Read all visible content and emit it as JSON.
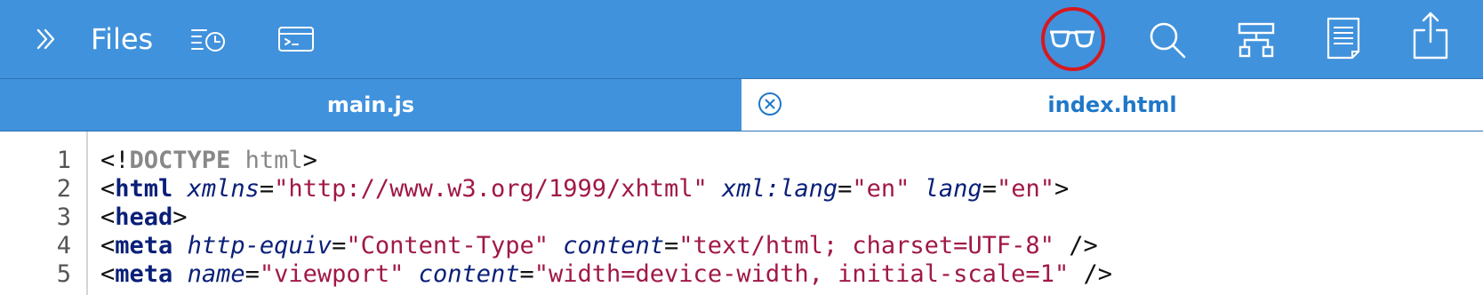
{
  "toolbar": {
    "files_label": "Files",
    "left_icons": [
      "chevron-double-right-icon",
      "recent-files-icon",
      "terminal-icon"
    ],
    "right_icons": [
      "reading-glasses-icon",
      "search-icon",
      "hierarchy-icon",
      "document-icon",
      "share-icon"
    ],
    "highlighted_icon": "reading-glasses-icon",
    "background_color": "#4192dc",
    "highlight_color": "#d61920"
  },
  "tabs": [
    {
      "label": "main.js",
      "active": false
    },
    {
      "label": "index.html",
      "active": true,
      "close_icon": "close-circle-icon"
    }
  ],
  "editor": {
    "lines": [
      {
        "number": "1",
        "tokens": [
          {
            "t": "punc",
            "v": "<!"
          },
          {
            "t": "doctype",
            "v": "DOCTYPE"
          },
          {
            "t": "doctype-name",
            "v": " html"
          },
          {
            "t": "punc",
            "v": ">"
          }
        ]
      },
      {
        "number": "2",
        "tokens": [
          {
            "t": "punc",
            "v": "<"
          },
          {
            "t": "tag",
            "v": "html"
          },
          {
            "t": "punc",
            "v": " "
          },
          {
            "t": "attr",
            "v": "xmlns"
          },
          {
            "t": "eq",
            "v": "="
          },
          {
            "t": "str",
            "v": "\"http://www.w3.org/1999/xhtml\""
          },
          {
            "t": "punc",
            "v": " "
          },
          {
            "t": "attr",
            "v": "xml:lang"
          },
          {
            "t": "eq",
            "v": "="
          },
          {
            "t": "str",
            "v": "\"en\""
          },
          {
            "t": "punc",
            "v": " "
          },
          {
            "t": "attr",
            "v": "lang"
          },
          {
            "t": "eq",
            "v": "="
          },
          {
            "t": "str",
            "v": "\"en\""
          },
          {
            "t": "punc",
            "v": ">"
          }
        ]
      },
      {
        "number": "3",
        "tokens": [
          {
            "t": "punc",
            "v": "<"
          },
          {
            "t": "tag",
            "v": "head"
          },
          {
            "t": "punc",
            "v": ">"
          }
        ]
      },
      {
        "number": "4",
        "tokens": [
          {
            "t": "punc",
            "v": "<"
          },
          {
            "t": "tag",
            "v": "meta"
          },
          {
            "t": "punc",
            "v": " "
          },
          {
            "t": "attr",
            "v": "http-equiv"
          },
          {
            "t": "eq",
            "v": "="
          },
          {
            "t": "str",
            "v": "\"Content-Type\""
          },
          {
            "t": "punc",
            "v": " "
          },
          {
            "t": "attr",
            "v": "content"
          },
          {
            "t": "eq",
            "v": "="
          },
          {
            "t": "str",
            "v": "\"text/html; charset=UTF-8\""
          },
          {
            "t": "punc",
            "v": " />"
          }
        ]
      },
      {
        "number": "5",
        "tokens": [
          {
            "t": "punc",
            "v": "<"
          },
          {
            "t": "tag",
            "v": "meta"
          },
          {
            "t": "punc",
            "v": " "
          },
          {
            "t": "attr",
            "v": "name"
          },
          {
            "t": "eq",
            "v": "="
          },
          {
            "t": "str",
            "v": "\"viewport\""
          },
          {
            "t": "punc",
            "v": " "
          },
          {
            "t": "attr",
            "v": "content"
          },
          {
            "t": "eq",
            "v": "="
          },
          {
            "t": "str",
            "v": "\"width=device-width, initial-scale=1\""
          },
          {
            "t": "punc",
            "v": " />"
          }
        ]
      }
    ]
  }
}
